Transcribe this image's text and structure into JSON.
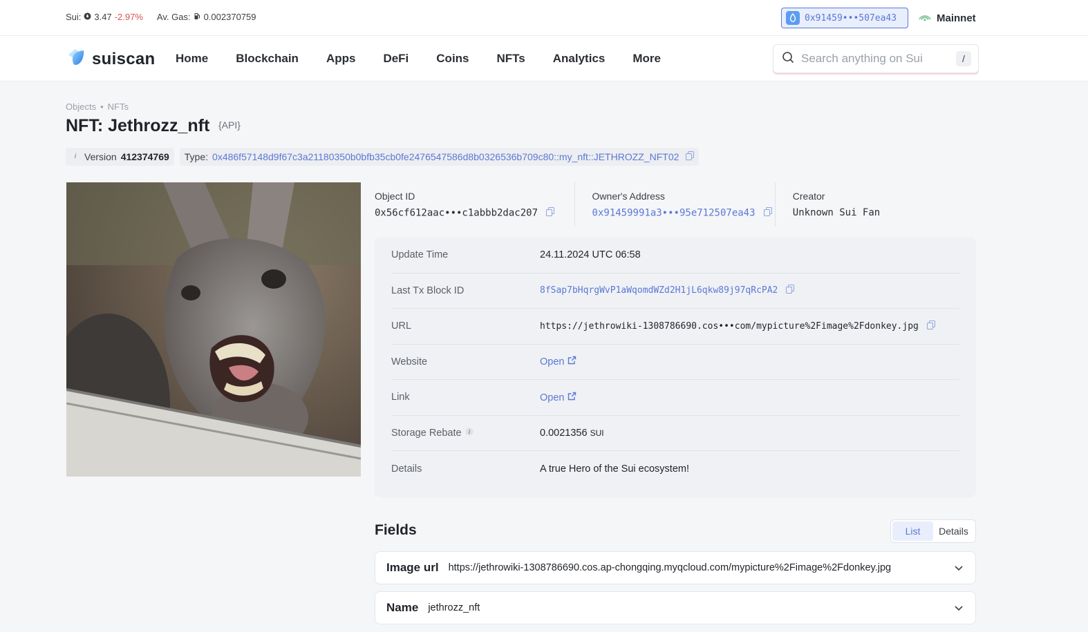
{
  "topbar": {
    "sui_label": "Sui:",
    "sui_price": "3.47",
    "sui_change": "-2.97%",
    "gas_label": "Av. Gas:",
    "gas_value": "0.002370759",
    "wallet_address": "0x91459•••507ea43",
    "network": "Mainnet"
  },
  "nav": {
    "logo": "suiscan",
    "links": [
      "Home",
      "Blockchain",
      "Apps",
      "DeFi",
      "Coins",
      "NFTs",
      "Analytics",
      "More"
    ],
    "search_placeholder": "Search anything on Sui",
    "search_shortcut": "/"
  },
  "header": {
    "breadcrumb": [
      "Objects",
      "NFTs"
    ],
    "breadcrumb_sep": "•",
    "title": "NFT: Jethrozz_nft",
    "api_tag": "{API}",
    "version_label": "Version",
    "version_value": "412374769",
    "type_label": "Type:",
    "type_value": "0x486f57148d9f67c3a21180350b0bfb35cb0fe2476547586d8b0326536b709c80::my_nft::JETHROZZ_NFT02"
  },
  "summary": {
    "object_id_label": "Object ID",
    "object_id": "0x56cf612aac•••c1abbb2dac207",
    "owner_label": "Owner's Address",
    "owner": "0x91459991a3•••95e712507ea43",
    "creator_label": "Creator",
    "creator": "Unknown Sui Fan"
  },
  "details": {
    "update_time_label": "Update Time",
    "update_time": "24.11.2024 UTC 06:58",
    "last_tx_label": "Last Tx Block ID",
    "last_tx": "8fSap7bHqrgWvP1aWqomdWZd2H1jL6qkw89j97qRcPA2",
    "url_label": "URL",
    "url": "https://jethrowiki-1308786690.cos•••com/mypicture%2Fimage%2Fdonkey.jpg",
    "website_label": "Website",
    "website": "Open",
    "link_label": "Link",
    "link": "Open",
    "storage_rebate_label": "Storage Rebate",
    "storage_rebate": "0.0021356",
    "storage_rebate_unit": "SUI",
    "details_label": "Details",
    "details": "A true Hero of the Sui ecosystem!"
  },
  "fields": {
    "title": "Fields",
    "toggle": [
      "List",
      "Details"
    ],
    "rows": [
      {
        "key": "Image url",
        "value": "https://jethrowiki-1308786690.cos.ap-chongqing.myqcloud.com/mypicture%2Fimage%2Fdonkey.jpg"
      },
      {
        "key": "Name",
        "value": "jethrozz_nft"
      }
    ]
  },
  "colors": {
    "accent": "#5b78d6",
    "negative": "#d9534f",
    "card_bg": "#eff1f4"
  }
}
